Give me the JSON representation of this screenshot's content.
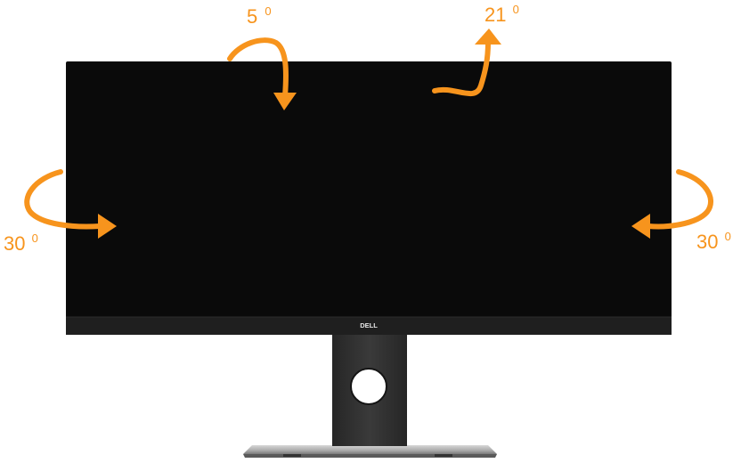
{
  "figure": {
    "monitor": {
      "brand_logo": "DELL",
      "bezel_color": "#0c0c0c",
      "screen_color": "#0a0a0a",
      "chin_color": "#1f1f1f",
      "stand_color": "#2e2e2e",
      "base_color": "#b9b9b9"
    },
    "arrow_color": "#f7941d",
    "tilt_forward": {
      "value": "5",
      "degree_mark": "0",
      "icon": "tilt-forward-arrow-icon"
    },
    "tilt_backward": {
      "value": "21",
      "degree_mark": "0",
      "icon": "tilt-backward-arrow-icon"
    },
    "swivel_left": {
      "value": "30",
      "degree_mark": "0",
      "icon": "swivel-left-arrow-icon"
    },
    "swivel_right": {
      "value": "30",
      "degree_mark": "0",
      "icon": "swivel-right-arrow-icon"
    }
  }
}
